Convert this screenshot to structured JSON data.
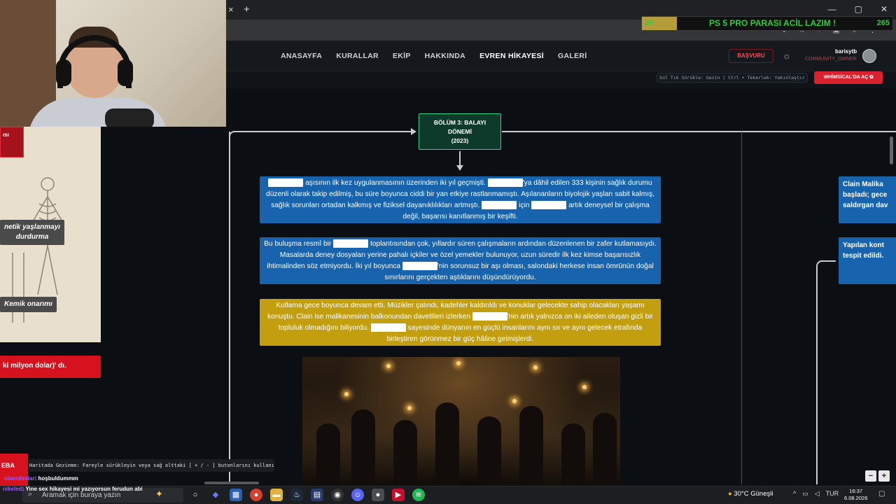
{
  "browser": {
    "tab_close": "×",
    "tab_new": "+",
    "window_controls": [
      "—",
      "▢",
      "✕"
    ]
  },
  "donation": {
    "current": "38",
    "title": "PS 5 PRO PARASI ACİL LAZIM !",
    "goal": "265",
    "progress_fraction": 0.14
  },
  "nav": {
    "links": [
      "ANASAYFA",
      "KURALLAR",
      "EKİP",
      "HAKKINDA",
      "EVREN HİKAYESİ",
      "GALERİ"
    ],
    "apply": "BAŞVURU",
    "username": "barisytb",
    "role": "COMMUNITY_OWNER"
  },
  "toolbar": {
    "hint": "Sol Tık Sürükle: Gezin | Ctrl + Tekerlek: Yakınlaştır",
    "whimsical": "WHİMSİCAL'DA AÇ ⧉"
  },
  "chapter": {
    "line1": "BÖLÜM 3: BALAYI",
    "line2": "DÖNEMİ",
    "line3": "(2023)"
  },
  "cards": {
    "c1": {
      "t1": "aşısının ilk kez uygulanmasının üzerinden iki yıl geçmişti.",
      "t2": "'ya dâhil edilen 333 kişinin sağlık durumu düzenli olarak takip edilmiş, bu süre boyunca ciddi bir yan etkiye rastlanmamıştı. Aşılananların biyolojik yaşları sabit kalmış, sağlık sorunları ortadan kalkmış ve fiziksel dayanıklılıkları artmıştı.",
      "t3": "için",
      "t4": "artık deneysel bir çalışma değil, başarısı kanıtlanmış bir keşifti."
    },
    "c2": {
      "t1": "Bu buluşma resmî bir",
      "t2": "toplantısından çok, yıllardır süren çalışmaların ardından düzenlenen bir zafer kutlamasıydı. Masalarda deney dosyaları yerine pahalı içkiler ve özel yemekler bulunuyor, uzun süredir ilk kez kimse başarısızlık ihtimalinden söz etmiyordu. İki yıl boyunca",
      "t3": "'nin sorunsuz bir aşı olması, salondaki herkese insan ömrünün doğal sınırlarını gerçekten aştıklarını düşündürüyordu."
    },
    "c3": {
      "t1": "Kutlama gece boyunca devam etti. Müzikler çalındı, kadehler kaldırıldı ve konuklar gelecekte sahip olacakları yaşamı konuştu. Clain ise malikanesinin balkonundan davetlileri izlerken",
      "t2": "'nin artık yalnızca on iki aileden oluşan gizli bir topluluk olmadığını biliyordu.",
      "t3": "sayesinde dünyanın en güçlü insanlarını aynı sır ve aynı gelecek etrafında birleştiren görünmez bir güç hâline gelmişlerdi."
    },
    "right1": "Clain Malika\nbaşladı; gece\nsaldırgan dav",
    "right2": "Yapılan kont\ntespit edildi."
  },
  "left_panel": {
    "red_tab": "ısı",
    "label_aging": "netik yaşlanmayı\ndurdurma",
    "label_bone": "Kemik onarımı",
    "quote": "ki milyon dolar)' dı."
  },
  "stream": {
    "red_badge": "EBA",
    "map_hint": "Haritada Gezinme: Fareyle sürükleyin veya sağ alttaki [ + / - ] butonlarını kullanın.",
    "chat1_user": "olaerdindar",
    "chat1_msg": ": hoşbuldummm",
    "chat2_user": "nikeled",
    "chat2_msg": ": Yine sex hikayesi mi yazıyorsun ferudun abi"
  },
  "zoom": {
    "minus": "−",
    "plus": "+"
  },
  "taskbar": {
    "search_placeholder": "Aramak için buraya yazın",
    "weather": "30°C  Güneşli",
    "lang": "TUR",
    "time": "16:37",
    "date": "6.08.2026"
  }
}
